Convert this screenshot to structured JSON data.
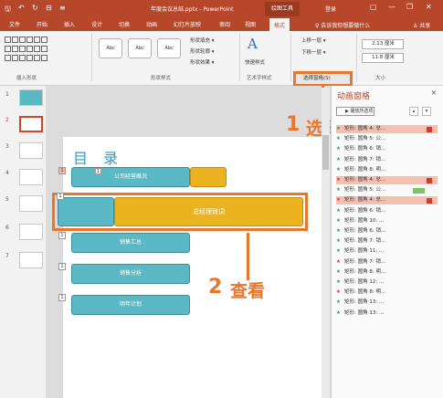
{
  "titlebar": {
    "quick_access": [
      "🖫",
      "↶",
      "↻",
      "⊟",
      "≡"
    ],
    "doc_title": "年度会议总结.pptx - PowerPoint",
    "context_tab": "绘图工具",
    "login": "登录",
    "win_buttons": [
      "▢",
      "—",
      "❐",
      "✕"
    ]
  },
  "tabs": [
    "文件",
    "开始",
    "插入",
    "设计",
    "切换",
    "动画",
    "幻灯片放映",
    "审阅",
    "视图",
    "格式"
  ],
  "active_tab": "格式",
  "tellme": "♀ 告诉我你想要做什么",
  "share": "♙ 共享",
  "ribbon": {
    "groups": {
      "insert_shapes": "插入形状",
      "shape_styles": "形状样式",
      "wordart": "艺术字样式",
      "size": "大小"
    },
    "style_presets": [
      "Abc",
      "Abc",
      "Abc"
    ],
    "shape_fill": "形状填充 ▾",
    "shape_outline": "形状轮廓 ▾",
    "shape_effects": "形状效果 ▾",
    "quick_styles": "快速样式",
    "wordart_letter": "A",
    "bring_forward": "上移一层 ▾",
    "send_backward": "下移一层 ▾",
    "selection_pane": "选择窗格(S)",
    "height": "2.13 厘米",
    "width": "11.8 厘米"
  },
  "thumbs": [
    "1",
    "2",
    "3",
    "4",
    "5",
    "6",
    "7"
  ],
  "slide": {
    "title": "目 录",
    "boxes": [
      "公司经营概况",
      "总经理致词",
      "销售汇总",
      "销售分析",
      "明年计划"
    ],
    "tags": [
      "1",
      "1",
      "1",
      "1",
      "1",
      "1"
    ]
  },
  "annotations": {
    "step1_num": "1",
    "step1_text": "选择",
    "step2_num": "2",
    "step2_text": "查看"
  },
  "anim_pane": {
    "title": "动画窗格",
    "close": "✕",
    "play": "▶ 播放所选项",
    "up": "▴",
    "down": "▾",
    "rows": [
      {
        "star": "★",
        "label": "矩形: 圆角 4: 总...",
        "highlight": true,
        "bar": "red"
      },
      {
        "star": "★",
        "label": "矩形: 圆角 5: 公...",
        "highlight": false,
        "bar": ""
      },
      {
        "star": "★",
        "label": "矩形: 圆角 6: 销...",
        "highlight": false,
        "bar": ""
      },
      {
        "star": "★",
        "label": "矩形: 圆角 7: 销...",
        "highlight": false,
        "bar": ""
      },
      {
        "star": "★",
        "label": "矩形: 圆角 8: 明...",
        "highlight": false,
        "bar": ""
      },
      {
        "star": "★",
        "label": "矩形: 圆角 4: 总...",
        "highlight": true,
        "bar": "red"
      },
      {
        "star": "★",
        "label": "矩形: 圆角 5: 公...",
        "highlight": false,
        "bar": "green"
      },
      {
        "star": "★",
        "label": "矩形: 圆角 4: 总...",
        "highlight": true,
        "bar": "red"
      },
      {
        "star": "★",
        "label": "矩形: 圆角 6: 销...",
        "highlight": false,
        "bar": ""
      },
      {
        "star": "★",
        "label": "矩形: 圆角 10: ...",
        "highlight": false,
        "bar": ""
      },
      {
        "star": "★",
        "label": "矩形: 圆角 6: 销...",
        "highlight": false,
        "bar": ""
      },
      {
        "star": "★",
        "label": "矩形: 圆角 7: 销...",
        "highlight": false,
        "bar": ""
      },
      {
        "star": "★",
        "label": "矩形: 圆角 11: ...",
        "highlight": false,
        "bar": ""
      },
      {
        "star": "★",
        "label": "矩形: 圆角 7: 销...",
        "highlight": false,
        "bar": ""
      },
      {
        "star": "★",
        "label": "矩形: 圆角 8: 明...",
        "highlight": false,
        "bar": ""
      },
      {
        "star": "★",
        "label": "矩形: 圆角 12: ...",
        "highlight": false,
        "bar": ""
      },
      {
        "star": "★",
        "label": "矩形: 圆角 8: 明...",
        "highlight": false,
        "bar": ""
      },
      {
        "star": "★",
        "label": "矩形: 圆角 13: ...",
        "highlight": false,
        "bar": ""
      },
      {
        "star": "★",
        "label": "矩形: 圆角 13: ...",
        "highlight": false,
        "bar": ""
      }
    ],
    "star_colors": [
      "#2f9e57",
      "#2f9e57",
      "#2f9e57",
      "#2f9e57",
      "#2f9e57",
      "#d63a2a",
      "#2f9e57",
      "#d63a2a",
      "#2f9e57",
      "#2f9e57",
      "#2f9e57",
      "#2f9e57",
      "#2f9e57",
      "#d63a2a",
      "#2f9e57",
      "#2f9e57",
      "#d63a2a",
      "#2f9e57",
      "#2f9e57"
    ]
  },
  "colors": {
    "accent": "#b7472a",
    "highlight": "#e8762d",
    "teal": "#5bb8c5",
    "gold": "#ebb320"
  }
}
